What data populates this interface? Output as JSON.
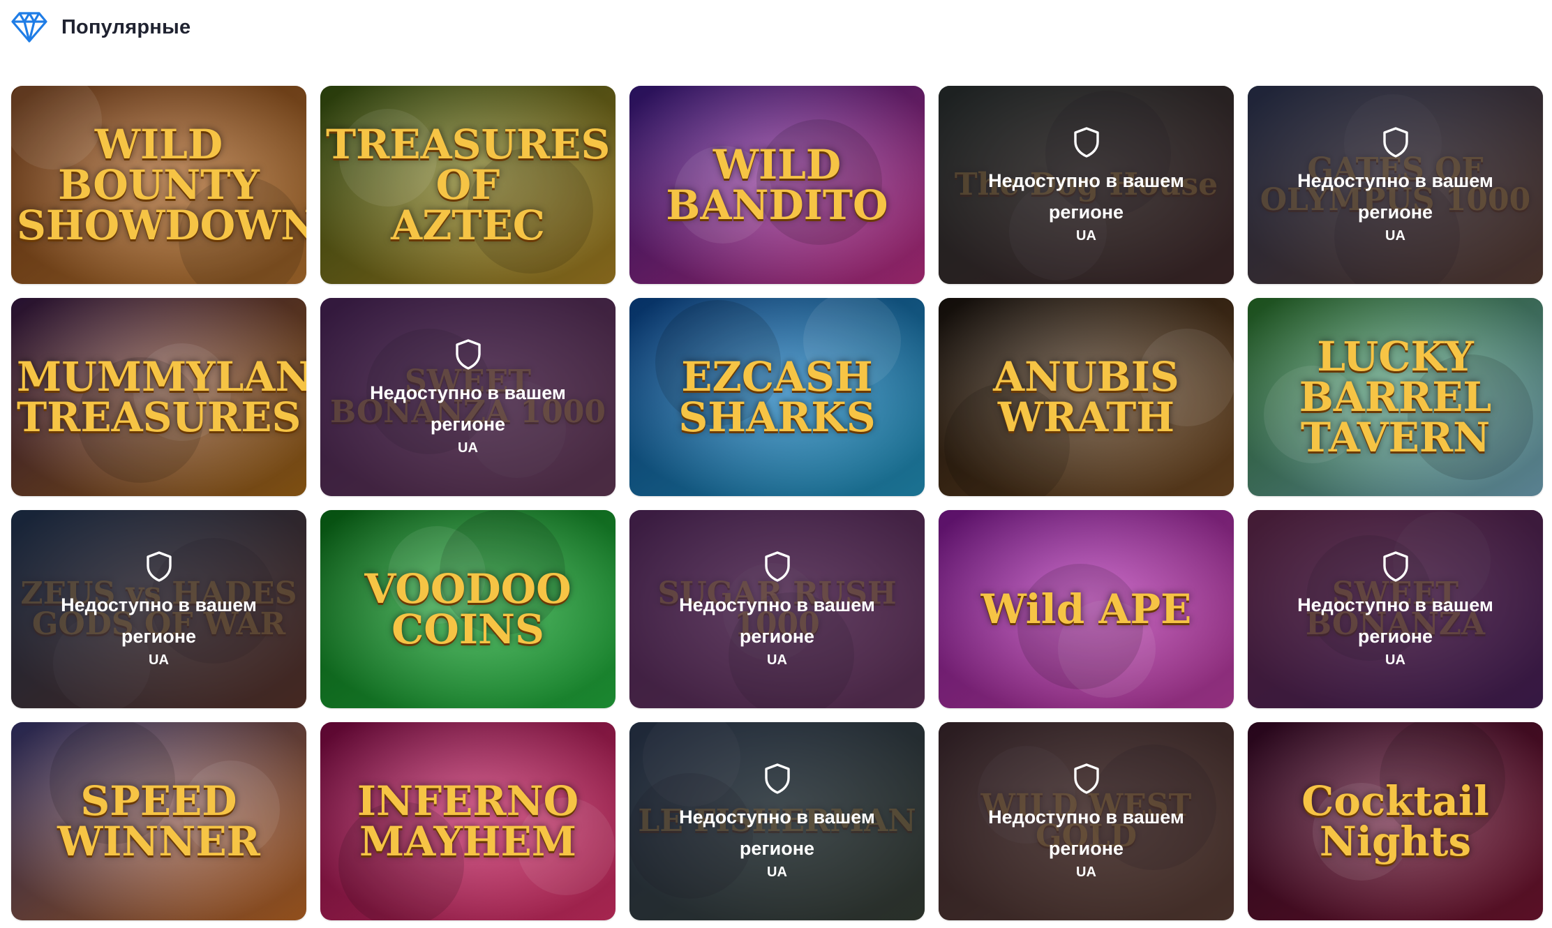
{
  "section": {
    "title": "Популярные",
    "icon": "diamond-icon",
    "accent": "#1f7de6"
  },
  "unavailable": {
    "message": "Недоступно в вашем регионе",
    "region": "UA",
    "icon": "shield-icon"
  },
  "games": [
    {
      "id": "wild-bounty-showdown",
      "title": "WILD BOUNTY\nSHOWDOWN",
      "available": true,
      "colors": [
        "#7a3b12",
        "#d98b3a"
      ]
    },
    {
      "id": "treasures-of-aztec",
      "title": "TREASURES OF\nAZTEC",
      "available": true,
      "colors": [
        "#3a5a12",
        "#c99a2a"
      ]
    },
    {
      "id": "wild-bandito",
      "title": "WILD\nBANDITO",
      "available": true,
      "colors": [
        "#3a1a8a",
        "#e0389a"
      ]
    },
    {
      "id": "the-dog-house",
      "title": "The Dog House",
      "available": false,
      "colors": [
        "#24501c",
        "#7a4a1a"
      ]
    },
    {
      "id": "gates-of-olympus-1000",
      "title": "GATES OF OLYMPUS 1000",
      "available": false,
      "colors": [
        "#2a5a7a",
        "#c88a3a"
      ]
    },
    {
      "id": "mummyland-treasures",
      "title": "MUMMYLAND\nTREASURES",
      "available": true,
      "colors": [
        "#3a1a4a",
        "#c27a1a"
      ]
    },
    {
      "id": "sweet-bonanza-1000",
      "title": "SWEET BONANZA 1000",
      "available": false,
      "colors": [
        "#7a2a8a",
        "#e07aa0"
      ]
    },
    {
      "id": "ezcash-sharks",
      "title": "EZCASH SHARKS",
      "available": true,
      "colors": [
        "#0a4a9a",
        "#2ab0e0"
      ]
    },
    {
      "id": "anubis-wrath",
      "title": "ANUBIS\nWRATH",
      "available": true,
      "colors": [
        "#1a1410",
        "#8a5a2a"
      ]
    },
    {
      "id": "lucky-barrel-tavern",
      "title": "LUCKY\nBARREL\nTAVERN",
      "available": true,
      "colors": [
        "#2a7a2a",
        "#8ac6e0"
      ]
    },
    {
      "id": "zeus-vs-hades",
      "title": "ZEUS vs HADES\nGODS OF WAR",
      "available": false,
      "colors": [
        "#0a5a7a",
        "#c86a1a"
      ]
    },
    {
      "id": "voodoo-coins",
      "title": "VOODOO\nCOINS",
      "available": true,
      "colors": [
        "#0a7a1a",
        "#2ad04a"
      ]
    },
    {
      "id": "sugar-rush-1000",
      "title": "SUGAR RUSH 1000",
      "available": false,
      "colors": [
        "#9a3a9a",
        "#e06ab0"
      ]
    },
    {
      "id": "wild-ape",
      "title": "Wild APE",
      "available": true,
      "colors": [
        "#8a1aa0",
        "#e04ac0"
      ]
    },
    {
      "id": "sweet-bonanza",
      "title": "SWEET BONANZA",
      "available": false,
      "colors": [
        "#c03a6a",
        "#8a2aa0"
      ]
    },
    {
      "id": "speed-winner",
      "title": "SPEED\nWINNER",
      "available": true,
      "colors": [
        "#3a3a7a",
        "#e07a2a"
      ]
    },
    {
      "id": "inferno-mayhem",
      "title": "INFERNO\nMAYHEM",
      "available": true,
      "colors": [
        "#8a0a4a",
        "#ff3a7a"
      ]
    },
    {
      "id": "le-fisherman",
      "title": "LE FISHERMAN",
      "available": false,
      "colors": [
        "#2a6a7a",
        "#5a8a3a"
      ]
    },
    {
      "id": "wild-west-gold",
      "title": "WILD WEST GOLD",
      "available": false,
      "colors": [
        "#5a3a1a",
        "#c88a3a"
      ]
    },
    {
      "id": "cocktail-nights",
      "title": "Cocktail\nNights",
      "available": true,
      "colors": [
        "#3a0a2a",
        "#8a1a3a"
      ]
    }
  ]
}
